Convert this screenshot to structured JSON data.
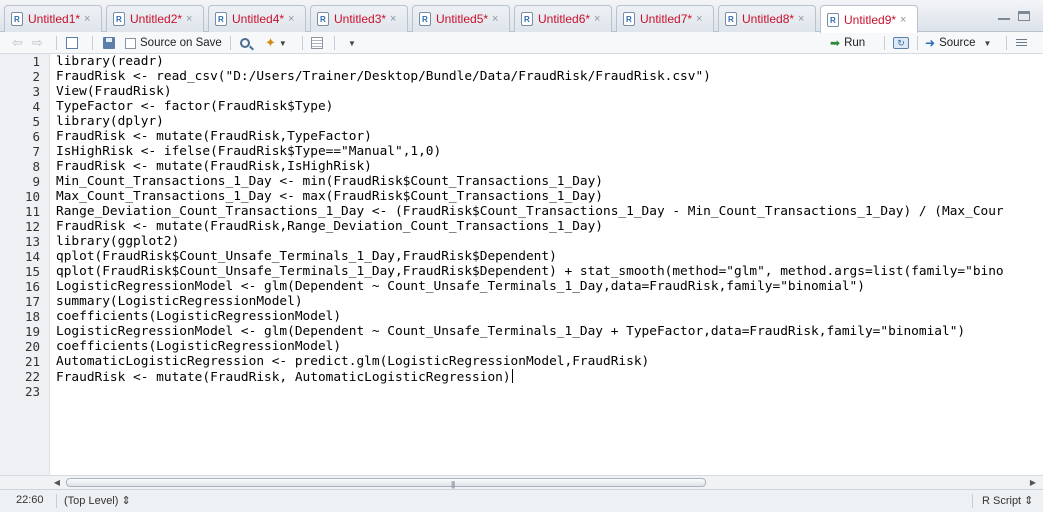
{
  "tabs": [
    {
      "label": "Untitled1*"
    },
    {
      "label": "Untitled2*"
    },
    {
      "label": "Untitled4*"
    },
    {
      "label": "Untitled3*"
    },
    {
      "label": "Untitled5*"
    },
    {
      "label": "Untitled6*"
    },
    {
      "label": "Untitled7*"
    },
    {
      "label": "Untitled8*"
    },
    {
      "label": "Untitled9*"
    }
  ],
  "active_tab_index": 8,
  "toolbar": {
    "source_on_save_label": "Source on Save",
    "source_on_save_checked": false,
    "run_label": "Run",
    "source_label": "Source"
  },
  "editor": {
    "lines": [
      "library(readr)",
      "FraudRisk <- read_csv(\"D:/Users/Trainer/Desktop/Bundle/Data/FraudRisk/FraudRisk.csv\")",
      "View(FraudRisk)",
      "TypeFactor <- factor(FraudRisk$Type)",
      "library(dplyr)",
      "FraudRisk <- mutate(FraudRisk,TypeFactor)",
      "IsHighRisk <- ifelse(FraudRisk$Type==\"Manual\",1,0)",
      "FraudRisk <- mutate(FraudRisk,IsHighRisk)",
      "Min_Count_Transactions_1_Day <- min(FraudRisk$Count_Transactions_1_Day)",
      "Max_Count_Transactions_1_Day <- max(FraudRisk$Count_Transactions_1_Day)",
      "Range_Deviation_Count_Transactions_1_Day <- (FraudRisk$Count_Transactions_1_Day - Min_Count_Transactions_1_Day) / (Max_Cour",
      "FraudRisk <- mutate(FraudRisk,Range_Deviation_Count_Transactions_1_Day)",
      "library(ggplot2)",
      "qplot(FraudRisk$Count_Unsafe_Terminals_1_Day,FraudRisk$Dependent)",
      "qplot(FraudRisk$Count_Unsafe_Terminals_1_Day,FraudRisk$Dependent) + stat_smooth(method=\"glm\", method.args=list(family=\"bino",
      "LogisticRegressionModel <- glm(Dependent ~ Count_Unsafe_Terminals_1_Day,data=FraudRisk,family=\"binomial\")",
      "summary(LogisticRegressionModel)",
      "coefficients(LogisticRegressionModel)",
      "LogisticRegressionModel <- glm(Dependent ~ Count_Unsafe_Terminals_1_Day + TypeFactor,data=FraudRisk,family=\"binomial\")",
      "coefficients(LogisticRegressionModel)",
      "AutomaticLogisticRegression <- predict.glm(LogisticRegressionModel,FraudRisk)",
      "FraudRisk <- mutate(FraudRisk, AutomaticLogisticRegression)",
      ""
    ],
    "line_numbers": [
      "1",
      "2",
      "3",
      "4",
      "5",
      "6",
      "7",
      "8",
      "9",
      "10",
      "11",
      "12",
      "13",
      "14",
      "15",
      "16",
      "17",
      "18",
      "19",
      "20",
      "21",
      "22",
      "23"
    ],
    "cursor_line": 22
  },
  "status": {
    "position": "22:60",
    "scope": "(Top Level) ⇕",
    "file_type": "R Script ⇕"
  },
  "colors": {
    "tab_label": "#c8102e",
    "gutter_bg": "#eef0f3",
    "code_text": "#000000"
  }
}
